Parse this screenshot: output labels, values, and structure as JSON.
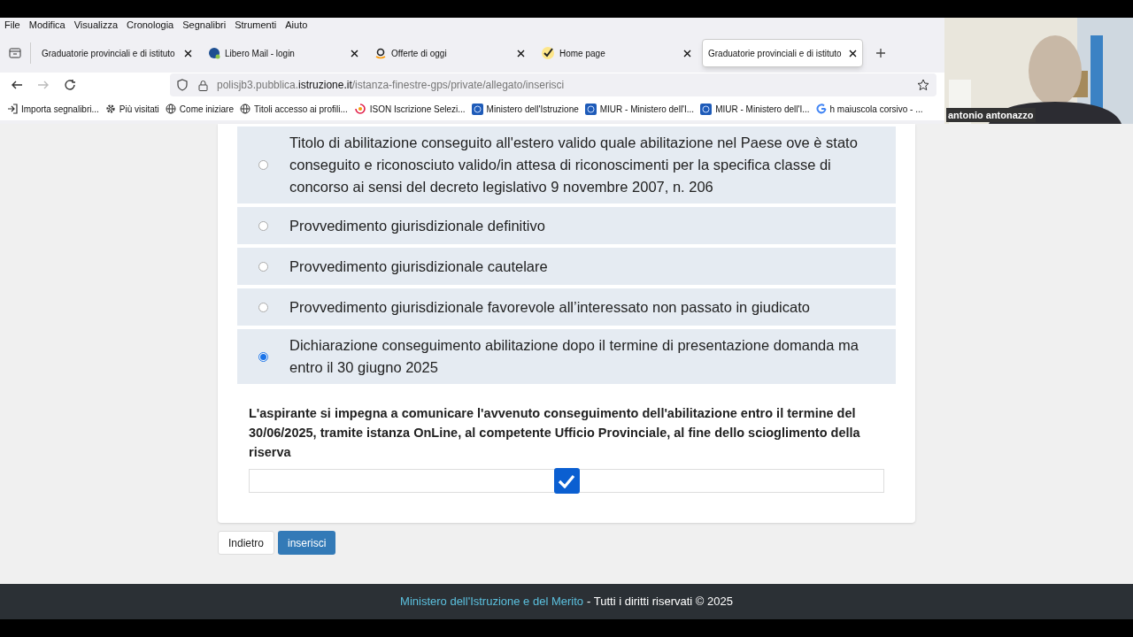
{
  "menu": [
    "File",
    "Modifica",
    "Visualizza",
    "Cronologia",
    "Segnalibri",
    "Strumenti",
    "Aiuto"
  ],
  "tabs": [
    {
      "title": "Graduatorie provinciali e di istituto",
      "selected": false,
      "kind": "doc"
    },
    {
      "title": "Libero Mail - login",
      "selected": false,
      "kind": "libero"
    },
    {
      "title": "Offerte di oggi",
      "selected": false,
      "kind": "amazon"
    },
    {
      "title": "Home page",
      "selected": false,
      "kind": "check"
    },
    {
      "title": "Graduatorie provinciali e di istituto",
      "selected": true,
      "kind": "doc"
    }
  ],
  "address": {
    "prefix": "polisjb3.pubblica.",
    "domain": "istruzione.it",
    "path": "/istanza-finestre-gps/private/allegato/inserisci"
  },
  "bookmarks": [
    {
      "label": "Importa segnalibri...",
      "kind": "import"
    },
    {
      "label": "Più visitati",
      "kind": "gear"
    },
    {
      "label": "Come iniziare",
      "kind": "globe"
    },
    {
      "label": "Titoli accesso ai profili...",
      "kind": "globe"
    },
    {
      "label": "ISON Iscrizione Selezi...",
      "kind": "ison"
    },
    {
      "label": "Ministero dell'Istruzione",
      "kind": "miur"
    },
    {
      "label": "MIUR - Ministero dell'I...",
      "kind": "miur"
    },
    {
      "label": "MIUR - Ministero dell'I...",
      "kind": "miur"
    },
    {
      "label": "h maiuscola corsivo - ...",
      "kind": "google"
    }
  ],
  "webcam": {
    "name": "antonio antonazzo"
  },
  "options": [
    {
      "label": "Titolo di abilitazione conseguito all'estero valido quale abilitazione nel Paese ove è stato conseguito e riconosciuto valido/in attesa di riconoscimenti per la specifica classe di concorso ai sensi del decreto legislativo 9 novembre 2007, n. 206",
      "selected": false
    },
    {
      "label": "Provvedimento giurisdizionale definitivo",
      "selected": false
    },
    {
      "label": "Provvedimento giurisdizionale cautelare",
      "selected": false
    },
    {
      "label": "Provvedimento giurisdizionale favorevole all’interessato non passato in giudicato",
      "selected": false
    },
    {
      "label": "Dichiarazione conseguimento abilitazione dopo il termine di presentazione domanda ma entro il 30 giugno 2025",
      "selected": true
    }
  ],
  "commitment": {
    "text": "L'aspirante si impegna a comunicare l'avvenuto conseguimento dell'abilitazione entro il termine del 30/06/2025, tramite istanza OnLine, al competente Ufficio Provinciale, al fine dello scioglimento della riserva",
    "checked": true
  },
  "buttons": [
    {
      "label": "Indietro",
      "kind": "secondary"
    },
    {
      "label": "inserisci",
      "kind": "primary"
    }
  ],
  "footer": {
    "link": "Ministero dell'Istruzione e del Merito",
    "text": "- Tutti i diritti riservati © 2025"
  }
}
